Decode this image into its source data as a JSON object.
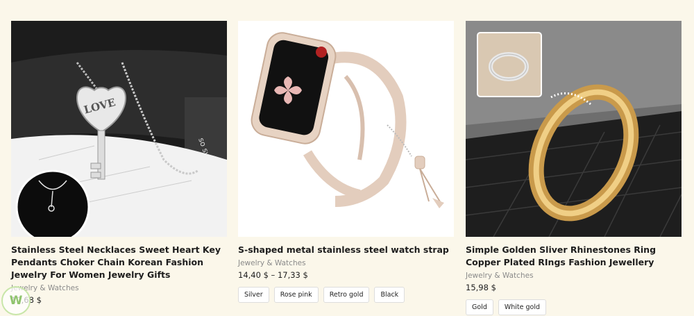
{
  "products": [
    {
      "title": "Stainless Steel Necklaces Sweet Heart Key Pendants Choker Chain Korean Fashion Jewelry For Women Jewelry Gifts",
      "category": "Jewelry & Watches",
      "price": "10,68 $",
      "image_text": "LOVE",
      "image_subtext": "so sweet"
    },
    {
      "title": "S-shaped metal stainless steel watch strap",
      "category": "Jewelry & Watches",
      "price": "14,40 $ – 17,33 $",
      "variants": [
        "Silver",
        "Rose pink",
        "Retro gold",
        "Black"
      ]
    },
    {
      "title": "Simple Golden Sliver Rhinestones Ring Copper Plated RIngs Fashion Jewellery",
      "category": "Jewelry & Watches",
      "price": "15,98 $",
      "variants": [
        "Gold",
        "White gold"
      ]
    }
  ],
  "badge": {
    "icon": "shield-leaf-icon",
    "text": "W"
  }
}
